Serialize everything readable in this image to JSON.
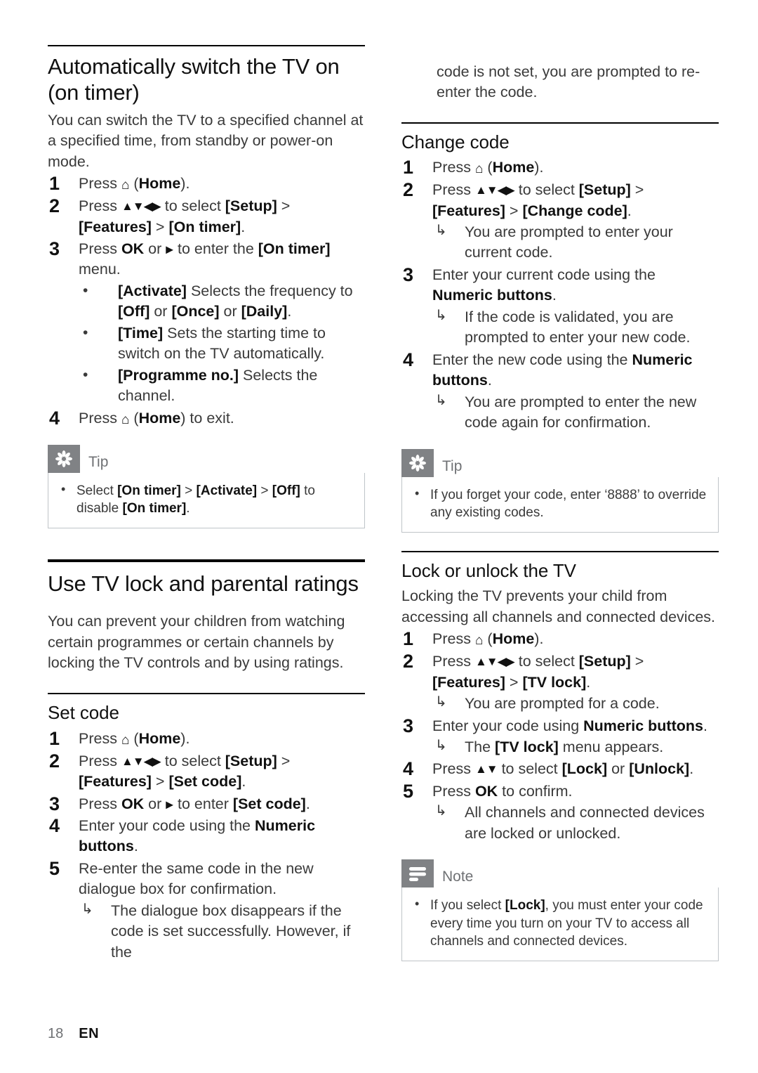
{
  "document": {
    "footer": {
      "page_number": "18",
      "language": "EN"
    },
    "icons": {
      "home": "home-icon",
      "nav_keys": "navigation-arrows-icon",
      "right_arrow": "right-arrow-icon",
      "result_arrow": "result-arrow-icon",
      "tip": "tip-asterisk-icon",
      "note": "note-lines-icon"
    },
    "colors": {
      "callout_icon_bg": "#808285",
      "callout_title": "#6f7174",
      "callout_border": "#bfc4c8",
      "body_text": "#3a3a3a",
      "heading": "#111111"
    }
  },
  "left_column": {
    "section_on_timer": {
      "heading": "Automatically switch the TV on (on timer)",
      "intro": "You can switch the TV to a specified channel at a specified time, from standby or power-on mode.",
      "steps": [
        {
          "num": "1",
          "prefix": "Press ",
          "home": "⌂",
          "suffix_bold": "Home",
          "text_after": "."
        },
        {
          "num": "2",
          "text": "Press ▲▼◀▶ to select [Setup] > [Features] > [On timer]."
        },
        {
          "num": "3",
          "text": "Press OK or ▶ to enter the [On timer] menu."
        },
        {
          "num": "4",
          "text": "Press ⌂ (Home) to exit."
        }
      ],
      "step3_bullets": [
        "[Activate] Selects the frequency to [Off] or [Once] or [Daily].",
        "[Time] Sets the starting time to switch on the TV automatically.",
        "[Programme no.] Selects the channel."
      ],
      "tip": {
        "title": "Tip",
        "items": [
          "Select [On timer] > [Activate] > [Off] to disable [On timer]."
        ]
      }
    },
    "section_tv_lock": {
      "heading": "Use TV lock and parental ratings",
      "intro": "You can prevent your children from watching certain programmes or certain channels by locking the TV controls and by using ratings."
    },
    "section_set_code": {
      "heading": "Set code",
      "steps": [
        {
          "num": "1",
          "text": "Press ⌂ (Home)."
        },
        {
          "num": "2",
          "text": "Press ▲▼◀▶ to select [Setup] > [Features] > [Set code]."
        },
        {
          "num": "3",
          "text": "Press OK or ▶ to enter [Set code]."
        },
        {
          "num": "4",
          "text": "Enter your code using the Numeric buttons."
        },
        {
          "num": "5",
          "text": "Re-enter the same code in the new dialogue box for confirmation."
        }
      ],
      "step5_result": "The dialogue box disappears if the code is set successfully. However, if the"
    }
  },
  "right_column": {
    "continuation": "code is not set, you are prompted to re-enter the code.",
    "section_change_code": {
      "heading": "Change code",
      "steps": [
        {
          "num": "1",
          "text": "Press ⌂ (Home)."
        },
        {
          "num": "2",
          "text": "Press ▲▼◀▶ to select [Setup] > [Features] > [Change code]."
        },
        {
          "num": "3",
          "text": "Enter your current code using the Numeric buttons."
        },
        {
          "num": "4",
          "text": "Enter the new code using the Numeric buttons."
        }
      ],
      "step2_result": "You are prompted to enter your current code.",
      "step3_result": "If the code is validated, you are prompted to enter your new code.",
      "step4_result": "You are prompted to enter the new code again for confirmation.",
      "tip": {
        "title": "Tip",
        "items": [
          "If you forget your code, enter ‘8888’ to override any existing codes."
        ]
      }
    },
    "section_lock_unlock": {
      "heading": "Lock or unlock the TV",
      "intro": "Locking the TV prevents your child from accessing all channels and connected devices.",
      "steps": [
        {
          "num": "1",
          "text": "Press ⌂ (Home)."
        },
        {
          "num": "2",
          "text": "Press ▲▼◀▶ to select [Setup] > [Features] > [TV lock]."
        },
        {
          "num": "3",
          "text": "Enter your code using Numeric buttons."
        },
        {
          "num": "4",
          "text": "Press ▲▼ to select [Lock] or [Unlock]."
        },
        {
          "num": "5",
          "text": "Press OK to confirm."
        }
      ],
      "step2_result": "You are prompted for a code.",
      "step3_result": "The [TV lock] menu appears.",
      "step5_result": "All channels and connected devices are locked or unlocked.",
      "note": {
        "title": "Note",
        "items": [
          "If you select [Lock], you must enter your code every time you turn on your TV to access all channels and connected devices."
        ]
      }
    }
  }
}
